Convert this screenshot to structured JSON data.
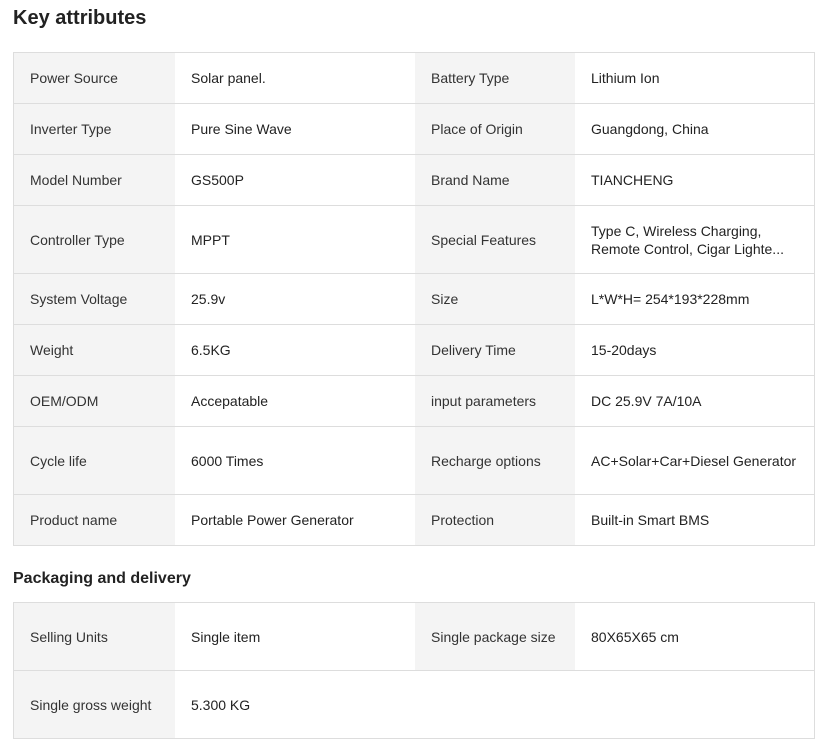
{
  "key_attributes": {
    "title": "Key attributes",
    "rows": [
      [
        {
          "k": "Power Source",
          "v": "Solar panel."
        },
        {
          "k": "Battery Type",
          "v": "Lithium Ion"
        }
      ],
      [
        {
          "k": "Inverter Type",
          "v": "Pure Sine Wave"
        },
        {
          "k": "Place of Origin",
          "v": "Guangdong, China"
        }
      ],
      [
        {
          "k": "Model Number",
          "v": "GS500P"
        },
        {
          "k": "Brand Name",
          "v": "TIANCHENG"
        }
      ],
      [
        {
          "k": "Controller Type",
          "v": "MPPT"
        },
        {
          "k": "Special Features",
          "v": "Type C, Wireless Charging, Remote Control, Cigar Lighte..."
        }
      ],
      [
        {
          "k": "System Voltage",
          "v": "25.9v"
        },
        {
          "k": "Size",
          "v": "L*W*H= 254*193*228mm"
        }
      ],
      [
        {
          "k": "Weight",
          "v": "6.5KG"
        },
        {
          "k": "Delivery Time",
          "v": "15-20days"
        }
      ],
      [
        {
          "k": "OEM/ODM",
          "v": "Accepatable"
        },
        {
          "k": "input parameters",
          "v": "DC 25.9V 7A/10A"
        }
      ],
      [
        {
          "k": "Cycle life",
          "v": "6000 Times"
        },
        {
          "k": "Recharge options",
          "v": "AC+Solar+Car+Diesel Generator"
        }
      ],
      [
        {
          "k": "Product name",
          "v": "Portable Power Generator"
        },
        {
          "k": "Protection",
          "v": "Built-in Smart BMS"
        }
      ]
    ]
  },
  "packaging": {
    "title": "Packaging and delivery",
    "rows": [
      [
        {
          "k": "Selling Units",
          "v": "Single item"
        },
        {
          "k": "Single package size",
          "v": "80X65X65 cm"
        }
      ],
      [
        {
          "k": "Single gross weight",
          "v": "5.300 KG"
        }
      ]
    ]
  }
}
